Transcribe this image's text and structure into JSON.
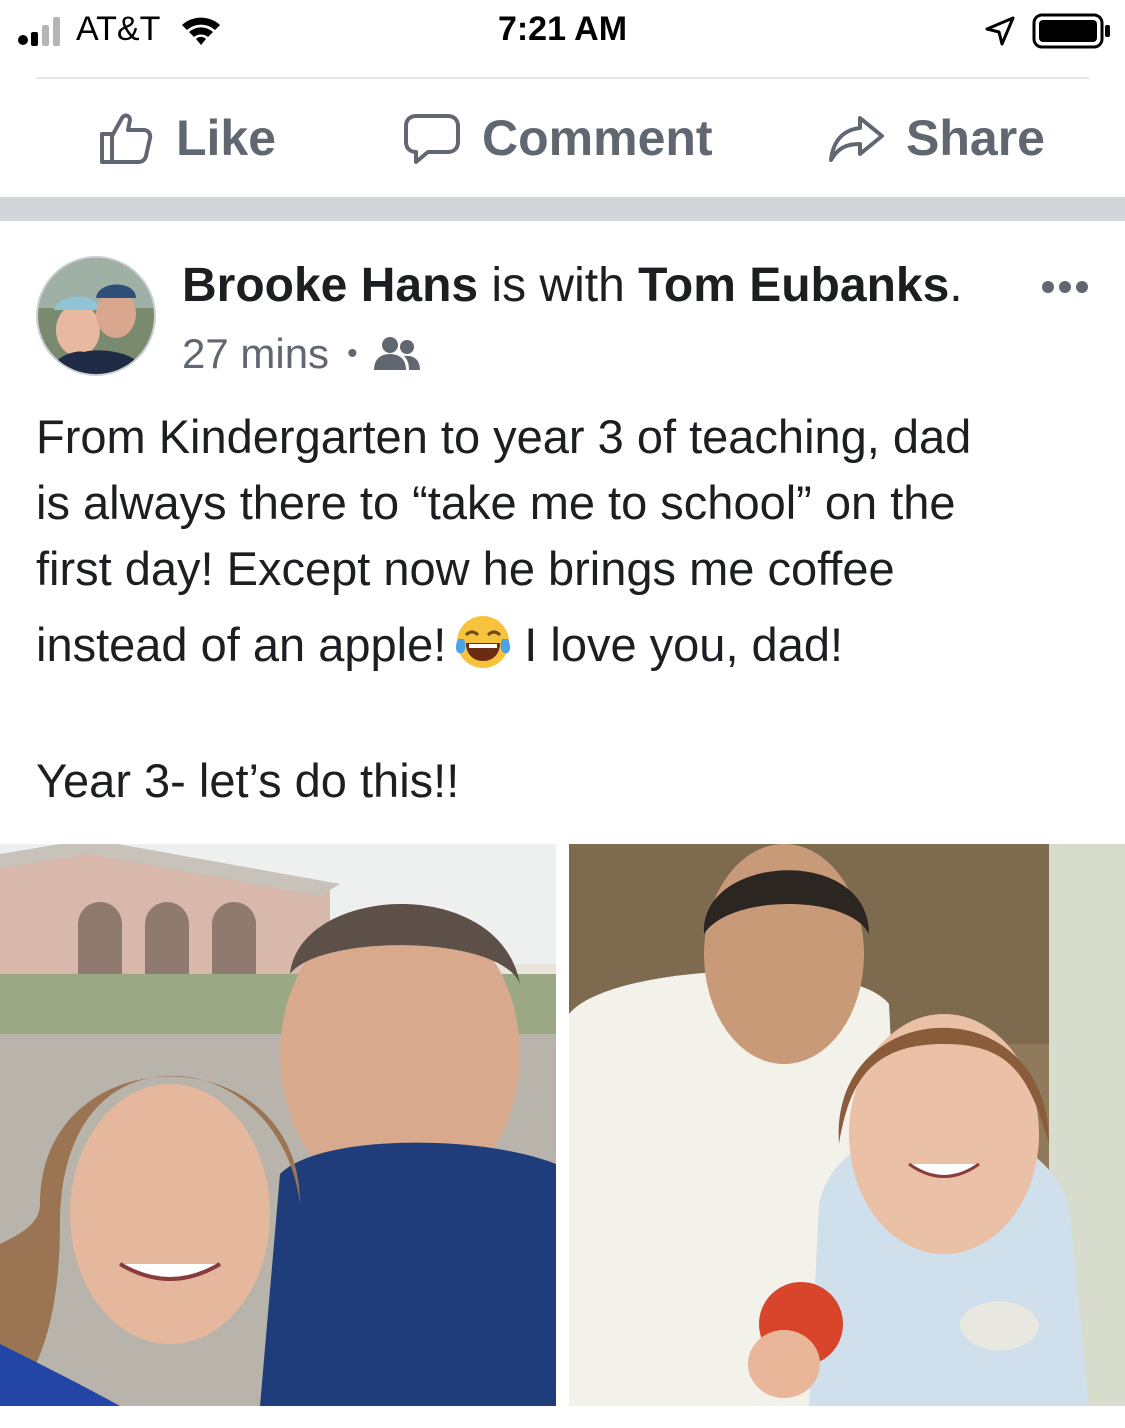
{
  "status_bar": {
    "carrier": "AT&T",
    "time": "7:21 AM",
    "icons": [
      "signal-icon",
      "wifi-icon",
      "location-arrow-icon",
      "battery-icon"
    ]
  },
  "actions": {
    "like": "Like",
    "comment": "Comment",
    "share": "Share"
  },
  "post": {
    "author": "Brooke Hans",
    "connector": " is with ",
    "tagged": "Tom Eubanks",
    "tagged_suffix": ".",
    "time": "27 mins",
    "audience_icon": "friends-icon",
    "text": {
      "line1": "From Kindergarten to year 3 of teaching, dad",
      "line2": "is always there to “take me to school” on the",
      "line3": "first day! Except now he brings me coffee",
      "line4a": "instead of an apple!",
      "line4b": "I love you, dad!",
      "line5": "Year 3- let’s do this!!"
    },
    "emoji": "face-with-tears-of-joy-icon"
  },
  "colors": {
    "text_primary": "#1c1e21",
    "text_secondary": "#606770",
    "feed_gap": "#d3d5da"
  }
}
